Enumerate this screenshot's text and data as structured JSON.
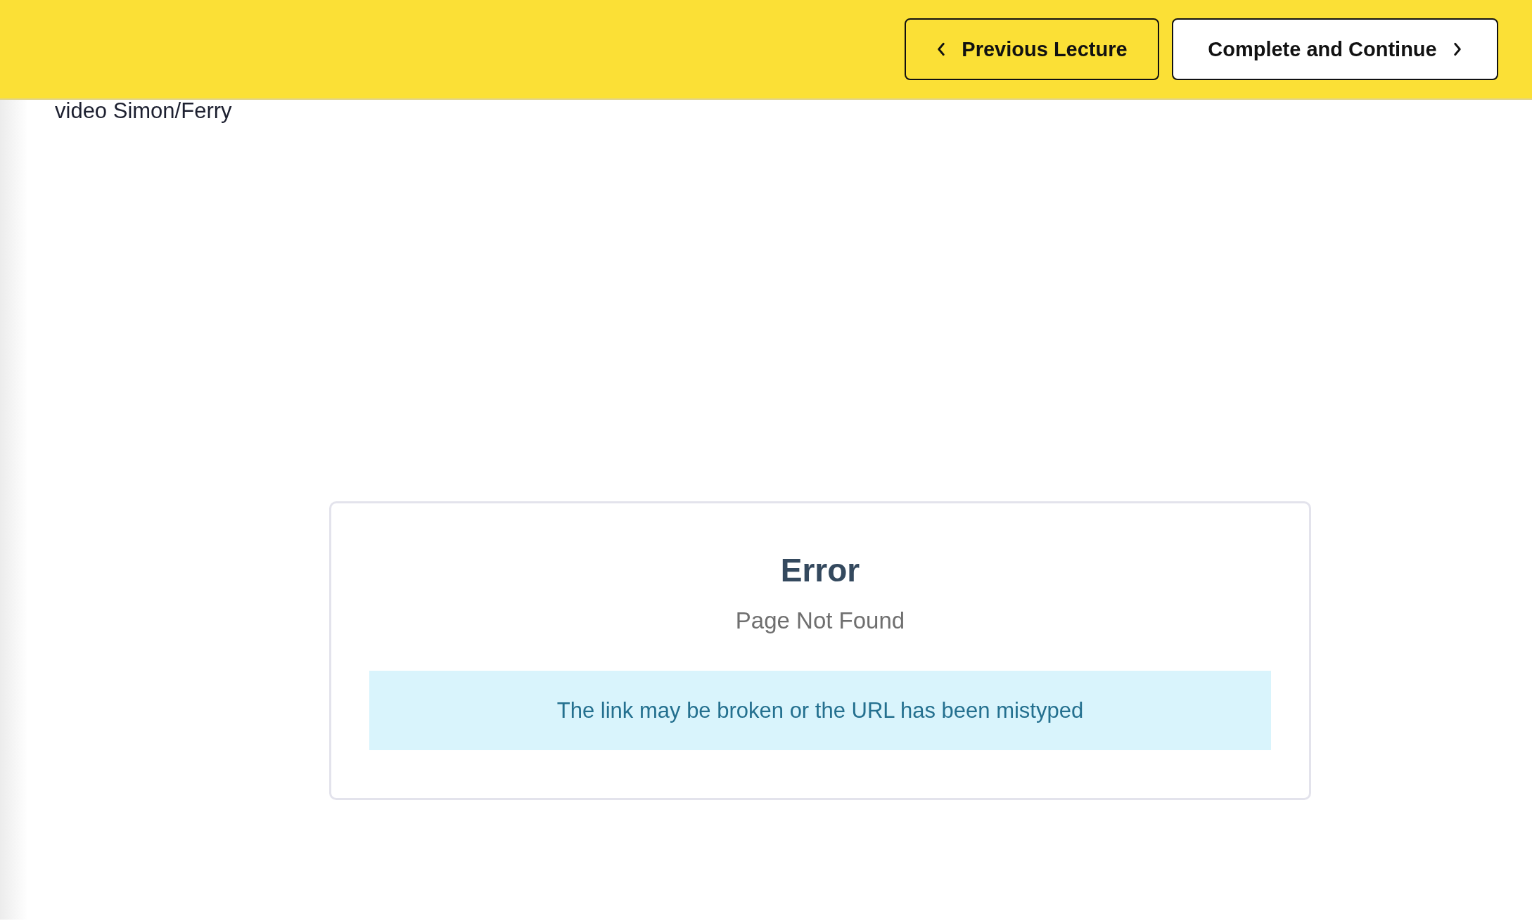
{
  "header": {
    "buttons": [
      {
        "kind": "previous",
        "label": "Previous Lecture"
      },
      {
        "kind": "next",
        "label": "Complete and Continue"
      }
    ]
  },
  "lecture": {
    "title": "video Simon/Ferry"
  },
  "error": {
    "title": "Error",
    "subtitle": "Page Not Found",
    "message": "The link may be broken or the URL has been mistyped"
  }
}
